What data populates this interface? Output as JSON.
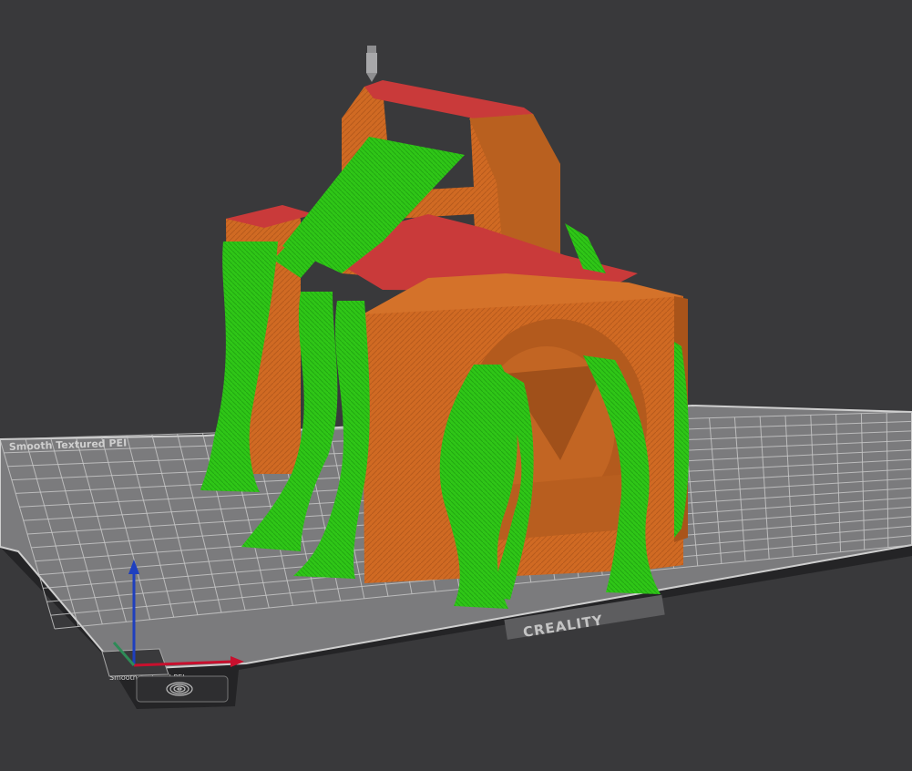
{
  "viewport": {
    "background": "#39393b"
  },
  "bed": {
    "top_label": "Smooth Textured PEI",
    "brand": "CREALITY",
    "bottom_left_label": "Smooth Textured PEI",
    "colors": {
      "plate": "#7b7b7d",
      "plate_edge": "#cfcfcf",
      "grid": "#c7c7c7",
      "frame": "#242426"
    }
  },
  "model": {
    "colors": {
      "wall": "#d06a23",
      "wall_dark": "#a9541a",
      "top_surface": "#c93a3a",
      "support": "#2fc617",
      "support_dark": "#1f9b10"
    }
  },
  "axes": {
    "x_color": "#c8102e",
    "y_color": "#2e8b57",
    "z_color": "#1e3fbf"
  },
  "icons": [
    "nozzle-icon",
    "fingerprint-icon"
  ]
}
